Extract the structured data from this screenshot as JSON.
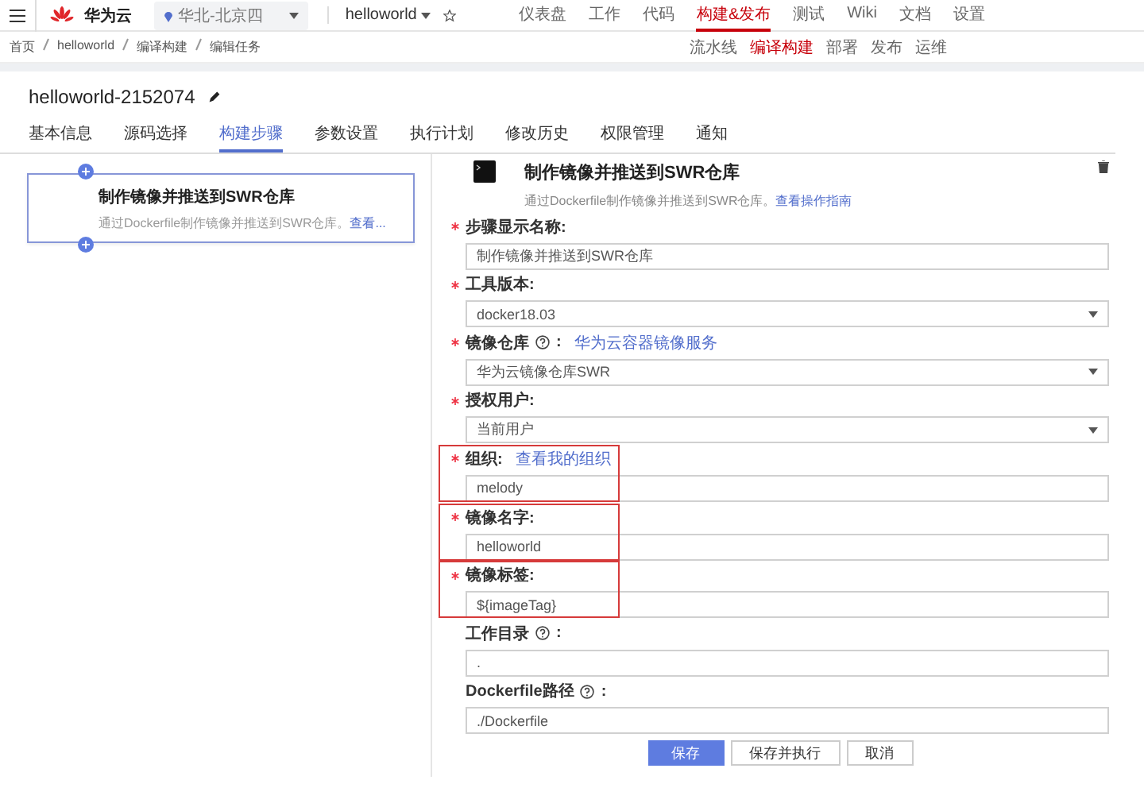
{
  "topbar": {
    "brand": "华为云",
    "region": "华北-北京四",
    "project": "helloworld",
    "nav": [
      {
        "label": "仪表盘",
        "selected": false
      },
      {
        "label": "工作",
        "selected": false
      },
      {
        "label": "代码",
        "selected": false
      },
      {
        "label": "构建&发布",
        "selected": true
      },
      {
        "label": "测试",
        "selected": false
      },
      {
        "label": "Wiki",
        "selected": false
      },
      {
        "label": "文档",
        "selected": false
      },
      {
        "label": "设置",
        "selected": false
      }
    ]
  },
  "breadcrumb": [
    "首页",
    "helloworld",
    "编译构建",
    "编辑任务"
  ],
  "subnav": [
    {
      "label": "流水线",
      "selected": false
    },
    {
      "label": "编译构建",
      "selected": true
    },
    {
      "label": "部署",
      "selected": false
    },
    {
      "label": "发布",
      "selected": false
    },
    {
      "label": "运维",
      "selected": false
    }
  ],
  "job": {
    "title": "helloworld-2152074"
  },
  "tabs": [
    {
      "label": "基本信息",
      "selected": false
    },
    {
      "label": "源码选择",
      "selected": false
    },
    {
      "label": "构建步骤",
      "selected": true
    },
    {
      "label": "参数设置",
      "selected": false
    },
    {
      "label": "执行计划",
      "selected": false
    },
    {
      "label": "修改历史",
      "selected": false
    },
    {
      "label": "权限管理",
      "selected": false
    },
    {
      "label": "通知",
      "selected": false
    }
  ],
  "steps": [
    {
      "title": "制作镜像并推送到SWR仓库",
      "description": "通过Dockerfile制作镜像并推送到SWR仓库。",
      "link": "查看...",
      "selected": true
    }
  ],
  "detail": {
    "title": "制作镜像并推送到SWR仓库",
    "description": "通过Dockerfile制作镜像并推送到SWR仓库。",
    "link": "查看操作指南",
    "fields": [
      {
        "label": "步骤显示名称:",
        "required": true,
        "help": false,
        "kind": "text",
        "value": "制作镜像并推送到SWR仓库",
        "highlighted": false
      },
      {
        "label": "工具版本:",
        "required": true,
        "help": false,
        "kind": "select",
        "value": "docker18.03",
        "highlighted": false
      },
      {
        "label": "镜像仓库",
        "required": true,
        "help": true,
        "suffix": ":",
        "link": "华为云容器镜像服务",
        "kind": "select",
        "value": "华为云镜像仓库SWR",
        "highlighted": false
      },
      {
        "label": "授权用户:",
        "required": true,
        "help": false,
        "kind": "select",
        "value": "当前用户",
        "highlighted": false
      },
      {
        "label": "组织:",
        "required": true,
        "help": false,
        "link": "查看我的组织",
        "kind": "text",
        "value": "melody",
        "highlighted": true
      },
      {
        "label": "镜像名字:",
        "required": true,
        "help": false,
        "kind": "text",
        "value": "helloworld",
        "highlighted": true
      },
      {
        "label": "镜像标签:",
        "required": true,
        "help": false,
        "kind": "text",
        "value": "${imageTag}",
        "highlighted": true
      },
      {
        "label": "工作目录",
        "required": false,
        "help": true,
        "suffix": ":",
        "kind": "text",
        "value": ".",
        "highlighted": false
      },
      {
        "label": "Dockerfile路径",
        "required": false,
        "help": true,
        "suffix": ":",
        "kind": "text",
        "value": "./Dockerfile",
        "highlighted": false
      }
    ]
  },
  "buttons": [
    {
      "label": "保存",
      "kind": "primary"
    },
    {
      "label": "保存并执行",
      "kind": "default"
    },
    {
      "label": "取消",
      "kind": "default"
    }
  ]
}
